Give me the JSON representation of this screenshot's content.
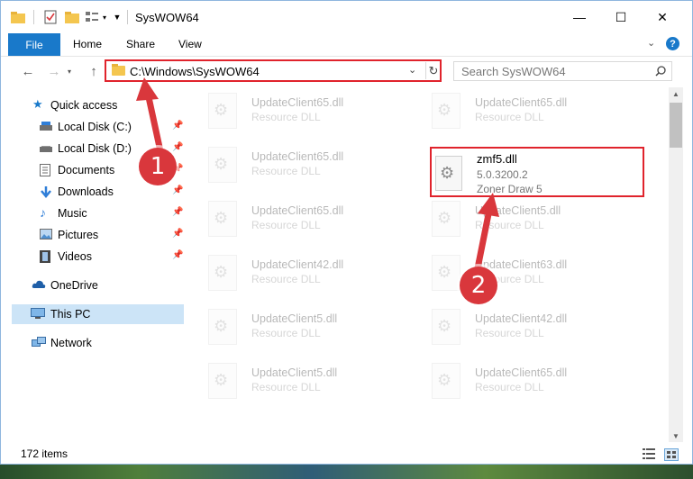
{
  "window": {
    "title": "SysWOW64",
    "controls": {
      "minimize": "—",
      "maximize": "☐",
      "close": "✕"
    }
  },
  "ribbon": {
    "tabs": [
      "File",
      "Home",
      "Share",
      "View"
    ],
    "collapse_icon": "chevron-down-icon",
    "help_icon": "help-icon"
  },
  "address": {
    "path": "C:\\Windows\\SysWOW64",
    "dropdown_glyph": "⌄",
    "refresh_glyph": "↻"
  },
  "search": {
    "placeholder": "Search SysWOW64",
    "icon": "magnifier-icon"
  },
  "sidebar": {
    "items": [
      {
        "label": "Quick access",
        "icon": "star-icon",
        "pinned": false
      },
      {
        "label": "Local Disk (C:)",
        "icon": "drive-icon",
        "pinned": true
      },
      {
        "label": "Local Disk (D:)",
        "icon": "drive-icon",
        "pinned": true
      },
      {
        "label": "Documents",
        "icon": "documents-icon",
        "pinned": true
      },
      {
        "label": "Downloads",
        "icon": "downloads-icon",
        "pinned": true
      },
      {
        "label": "Music",
        "icon": "music-icon",
        "pinned": true
      },
      {
        "label": "Pictures",
        "icon": "pictures-icon",
        "pinned": true
      },
      {
        "label": "Videos",
        "icon": "videos-icon",
        "pinned": true
      },
      {
        "label": "OneDrive",
        "icon": "cloud-icon",
        "pinned": false
      },
      {
        "label": "This PC",
        "icon": "computer-icon",
        "pinned": false,
        "selected": true
      },
      {
        "label": "Network",
        "icon": "network-icon",
        "pinned": false
      }
    ]
  },
  "files": [
    {
      "name": "UpdateClient65.dll",
      "type": "Resource DLL"
    },
    {
      "name": "UpdateClient65.dll",
      "type": "Resource DLL"
    },
    {
      "name": "UpdateClient65.dll",
      "type": "Resource DLL"
    },
    {
      "name": "UpdateClient65.dll",
      "type": "Resource DLL"
    },
    {
      "name": "UpdateClient5.dll",
      "type": "Resource DLL"
    },
    {
      "name": "UpdateClient42.dll",
      "type": "Resource DLL"
    },
    {
      "name": "UpdateClient63.dll",
      "type": "Resource DLL"
    },
    {
      "name": "UpdateClient5.dll",
      "type": "Resource DLL"
    },
    {
      "name": "UpdateClient42.dll",
      "type": "Resource DLL"
    },
    {
      "name": "UpdateClient5.dll",
      "type": "Resource DLL"
    },
    {
      "name": "UpdateClient65.dll",
      "type": "Resource DLL"
    }
  ],
  "highlighted_file": {
    "name": "zmf5.dll",
    "version": "5.0.3200.2",
    "description": "Zoner Draw 5"
  },
  "status": {
    "item_count": "172 items"
  },
  "annotations": {
    "step1": "1",
    "step2": "2",
    "color": "#d9373c"
  },
  "colors": {
    "accent": "#1979ca",
    "highlight_border": "#e0232c",
    "selected_nav": "#cce4f7"
  }
}
